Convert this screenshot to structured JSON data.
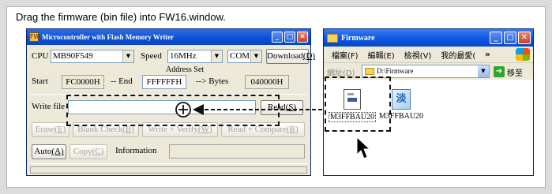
{
  "caption": "Drag the firmware (bin file) into FW16.window.",
  "left_window": {
    "title": "Microcontroller with Flash Memory Writer",
    "app_icon": "FW",
    "titlebar_buttons": {
      "minimize": "_",
      "maximize": "□",
      "close": "✕"
    },
    "cpu_label": "CPU",
    "cpu_value": "MB90F549",
    "speed_label": "Speed",
    "speed_value": "16MHz",
    "com_value": "COM1",
    "download_label": "Download",
    "download_key": "(D)",
    "address_set_label": "Address Set",
    "start_label": "Start",
    "start_value": "FC0000H",
    "end_label": "-- End",
    "end_value": "FFFFFFH",
    "bytes_label": "--> Bytes",
    "bytes_value": "040000H",
    "write_file_label": "Write file",
    "write_file_value": "",
    "read_label": "Read",
    "read_key": "(S)",
    "erase_label": "Erase",
    "erase_key": "(E)",
    "blank_check_label": "Blank Check",
    "blank_check_key": "(B)",
    "write_verify_label": "Write + Verify",
    "write_verify_key": "(W)",
    "read_compare_label": "Read + Compare",
    "read_compare_key": "(R)",
    "auto_label": "Auto",
    "auto_key": "(A)",
    "copy_label": "Copy",
    "copy_key": "(C)",
    "information_label": "Information",
    "information_value": ""
  },
  "right_window": {
    "title": "Firmware",
    "titlebar_buttons": {
      "minimize": "_",
      "maximize": "□",
      "close": "✕"
    },
    "menu": [
      "檔案(F)",
      "編輯(E)",
      "檢視(V)",
      "我的最愛("
    ],
    "menu_more": "»",
    "address_label": "網址(D)",
    "address_value": "D:\\Firmware",
    "go_label": "移至",
    "files": [
      {
        "name": "M3FFBAU20",
        "icon": "bin-file-icon",
        "selected": true
      },
      {
        "name": "M3FFBAU20",
        "icon": "xp-app-icon",
        "badge": "淡",
        "selected": false
      }
    ]
  },
  "annotations": {
    "drop_target_icon": "⊕"
  }
}
